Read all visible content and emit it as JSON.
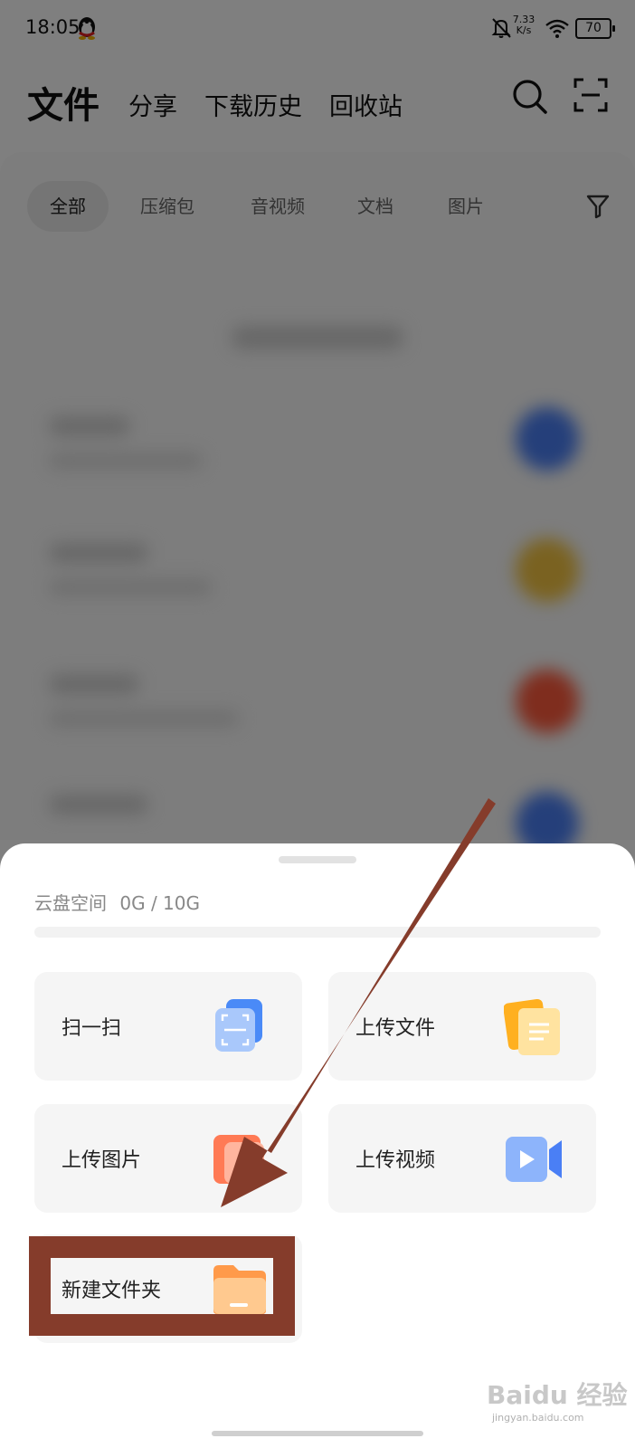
{
  "status_bar": {
    "time": "18:05",
    "net_speed_value": "7.33",
    "net_speed_unit": "K/s",
    "battery": "70"
  },
  "top_nav": {
    "title": "文件",
    "tabs": [
      "分享",
      "下载历史",
      "回收站"
    ]
  },
  "filters": {
    "chips": [
      "全部",
      "压缩包",
      "音视频",
      "文档",
      "图片"
    ],
    "active": "全部"
  },
  "sheet": {
    "storage_label": "云盘空间",
    "storage_value": "0G / 10G",
    "storage_used_fraction": 0,
    "actions": [
      {
        "label": "扫一扫",
        "icon": "scan-icon"
      },
      {
        "label": "上传文件",
        "icon": "upload-file-icon"
      },
      {
        "label": "上传图片",
        "icon": "upload-image-icon"
      },
      {
        "label": "上传视频",
        "icon": "upload-video-icon"
      },
      {
        "label": "新建文件夹",
        "icon": "new-folder-icon"
      }
    ]
  },
  "colors": {
    "annotation": "#853c2b",
    "accent_blue": "#4a7ff5",
    "accent_orange": "#ff9a4a"
  },
  "watermark": {
    "text": "Baidu 经验",
    "sub": "jingyan.baidu.com"
  }
}
